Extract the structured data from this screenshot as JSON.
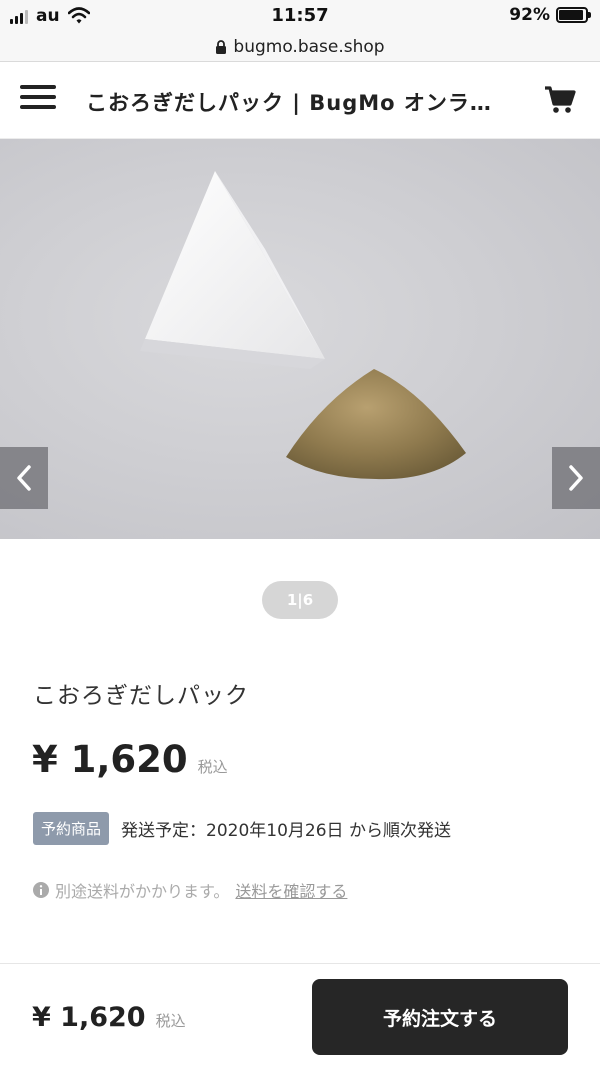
{
  "status_bar": {
    "carrier": "au",
    "time": "11:57",
    "battery": "92%",
    "battery_level": 0.92
  },
  "url_bar": {
    "url": "bugmo.base.shop"
  },
  "header": {
    "title": "こおろぎだしパック | BugMo オンラ…"
  },
  "carousel": {
    "pager": "1|6"
  },
  "product": {
    "name": "こおろぎだしパック",
    "price": "¥ 1,620",
    "tax_label": "税込",
    "preorder_badge": "予約商品",
    "shipping_schedule": "発送予定：2020年10月26日 から順次発送",
    "shipping_notice": "別途送料がかかります。",
    "shipping_link": "送料を確認する"
  },
  "bottom_bar": {
    "price": "¥ 1,620",
    "tax_label": "税込",
    "order_button": "予約注文する"
  },
  "icons": {
    "signal": "signal-icon",
    "wifi": "wifi-icon",
    "battery": "battery-icon",
    "lock": "lock-icon",
    "menu": "hamburger-menu-icon",
    "cart": "cart-icon",
    "prev": "chevron-left-icon",
    "next": "chevron-right-icon",
    "info": "info-icon"
  },
  "colors": {
    "order_button_bg": "#262626",
    "preorder_badge_bg": "#8e9aab",
    "pager_bg": "#d6d6d6"
  }
}
